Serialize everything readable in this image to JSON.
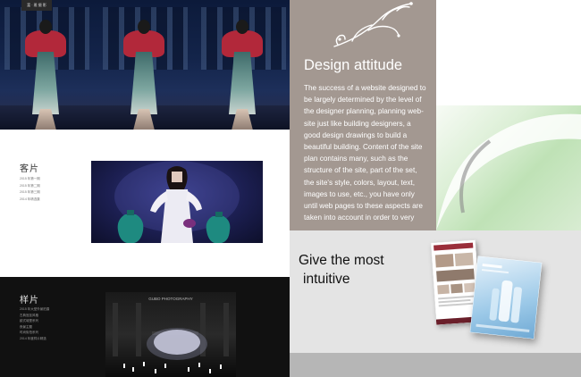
{
  "hero": {
    "logo_text": "富 · 雅 摄 影"
  },
  "section_client": {
    "title": "客片",
    "items": [
      "2015 年第一期",
      "2015 年第二期",
      "2015 年第三期",
      "2014 年精选集"
    ]
  },
  "section_sample": {
    "title": "样片",
    "items": [
      "2015 年大型外景拍摄",
      "古典宫廷风格",
      "欧式城堡系列",
      "夜景主题",
      "时尚街拍系列",
      "2014 年度样片精选"
    ]
  },
  "photo2": {
    "caption": "GUBO PHOTOGRAPHY"
  },
  "design_panel": {
    "heading": "Design attitude",
    "body": "The success of a website designed to be largely determined by the level of the designer planning, planning web-site just like building designers, a good design drawings to build a beautiful building. Content of the site plan contains many, such as the structure of the site, part of the set, the site's style, colors, layout, text, images to use, etc., you have only until web pages to these aspects are taken into account in order to very"
  },
  "promo": {
    "line1": "Give the most",
    "line2": "intuitive"
  },
  "colors": {
    "tan_panel": "#a39891",
    "gray_panel": "#e4e4e4",
    "dark_section": "#111111"
  }
}
